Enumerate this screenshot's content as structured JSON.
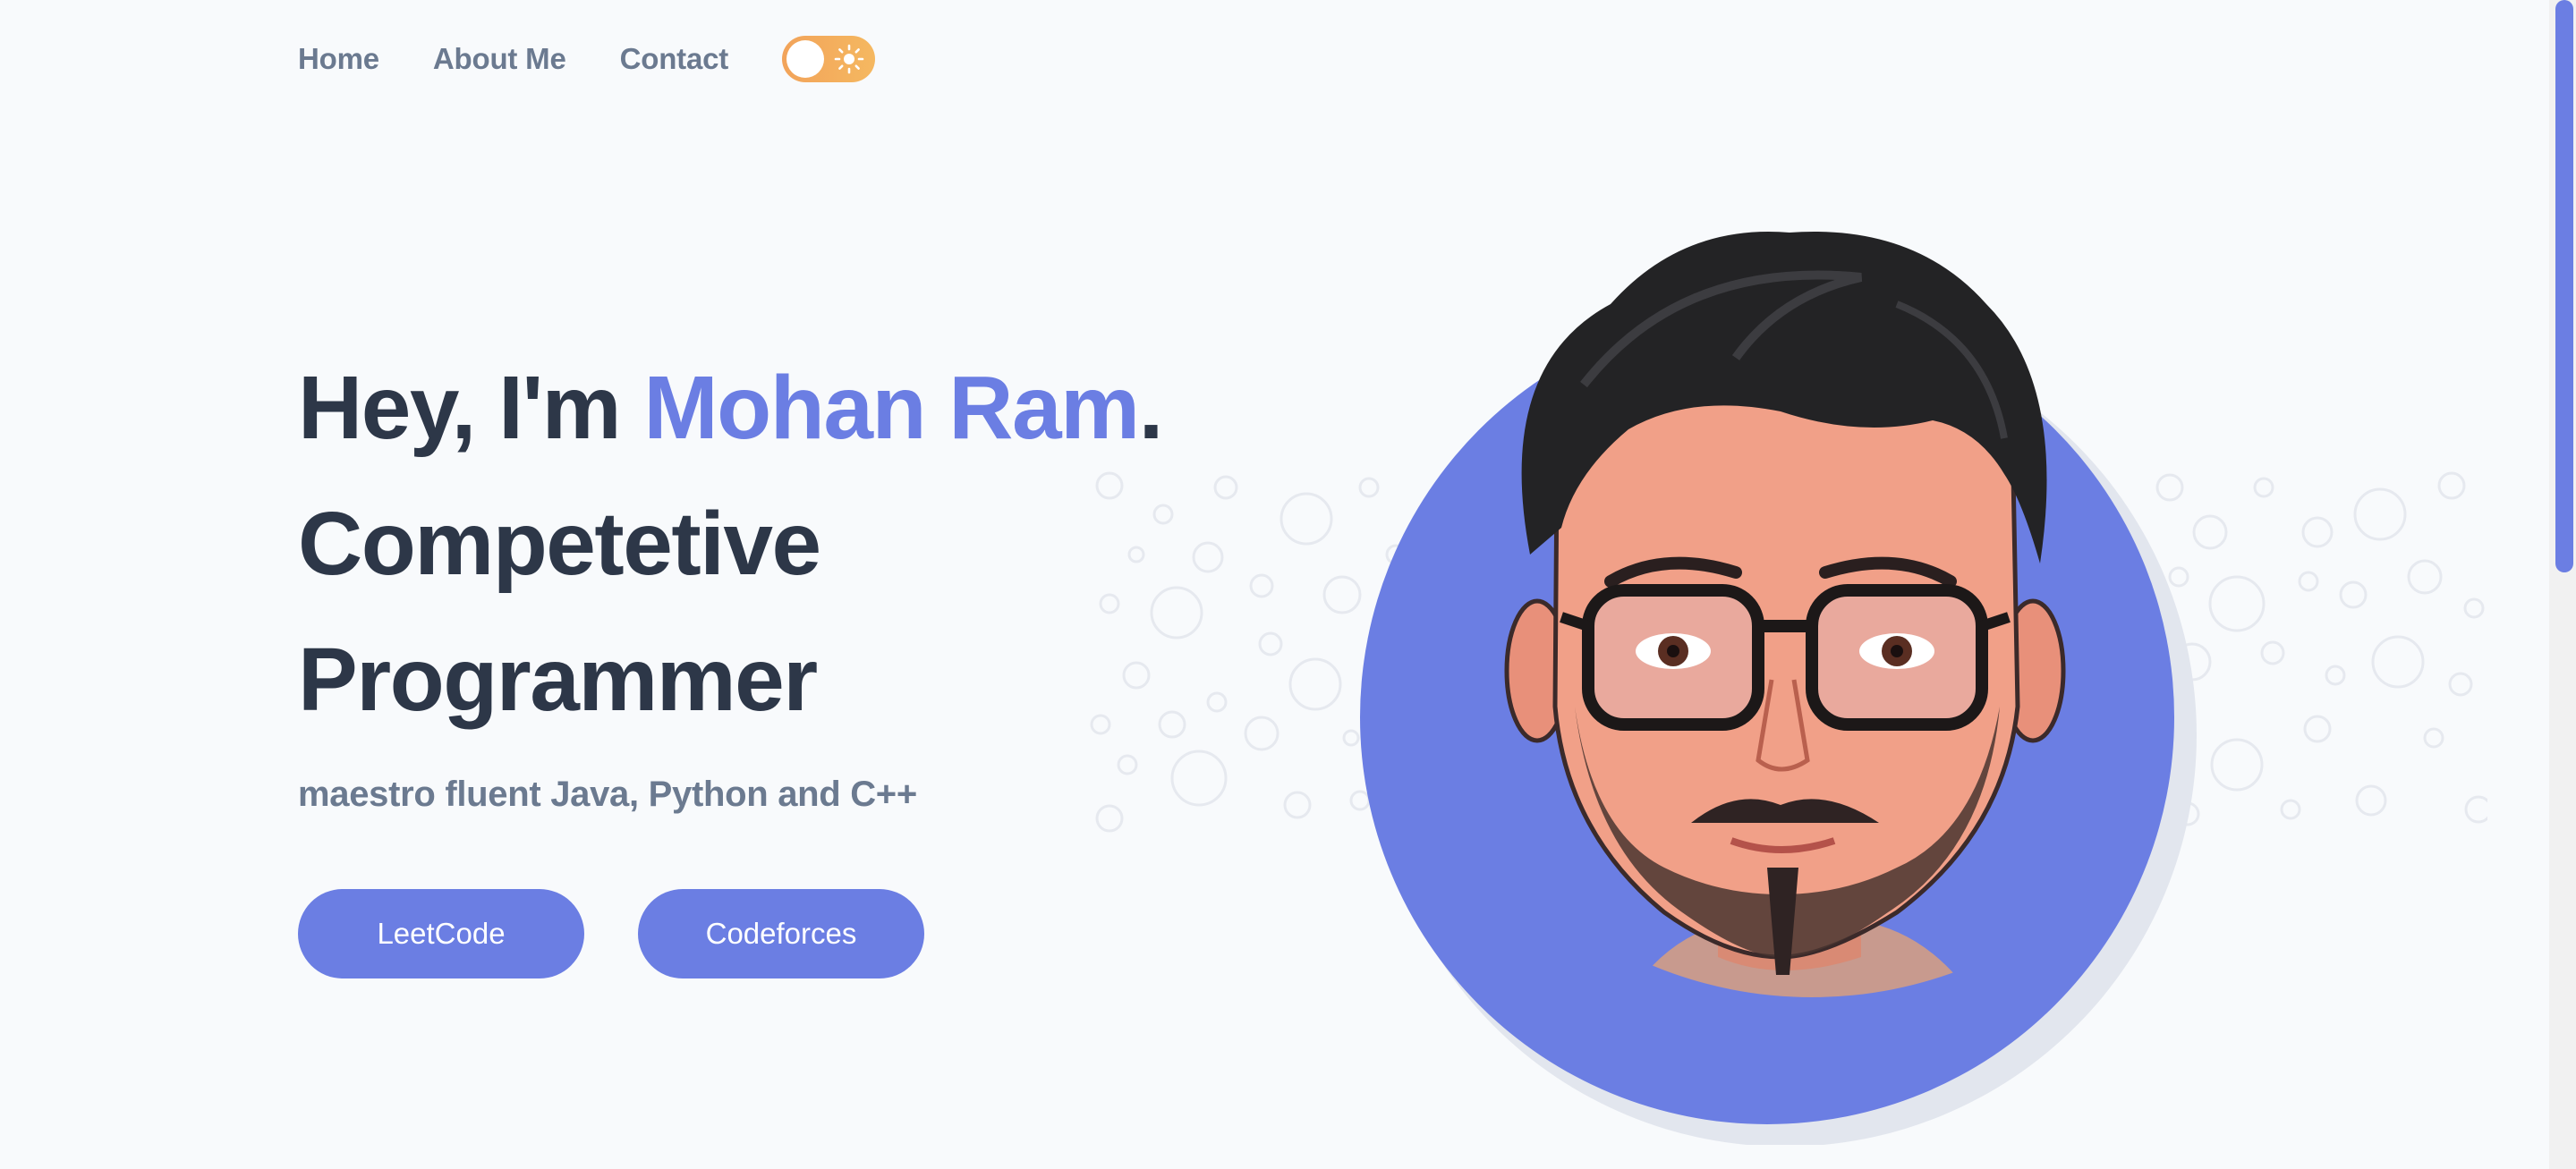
{
  "nav": {
    "links": [
      "Home",
      "About Me",
      "Contact"
    ],
    "theme_toggle_icon": "sun-icon"
  },
  "hero": {
    "greeting_prefix": "Hey, I'm ",
    "name": "Mohan Ram",
    "greeting_suffix": ".",
    "role_line_1": "Competetive",
    "role_line_2": "Programmer",
    "subtitle": "maestro fluent Java, Python and C++"
  },
  "buttons": {
    "leetcode": "LeetCode",
    "codeforces": "Codeforces"
  },
  "colors": {
    "accent": "#6b7ee3",
    "heading": "#2d3748",
    "muted": "#6b7a90",
    "toggle": "#f2a35a",
    "background": "#f8fafc"
  },
  "avatar": {
    "icon": "profile-avatar-illustration"
  }
}
